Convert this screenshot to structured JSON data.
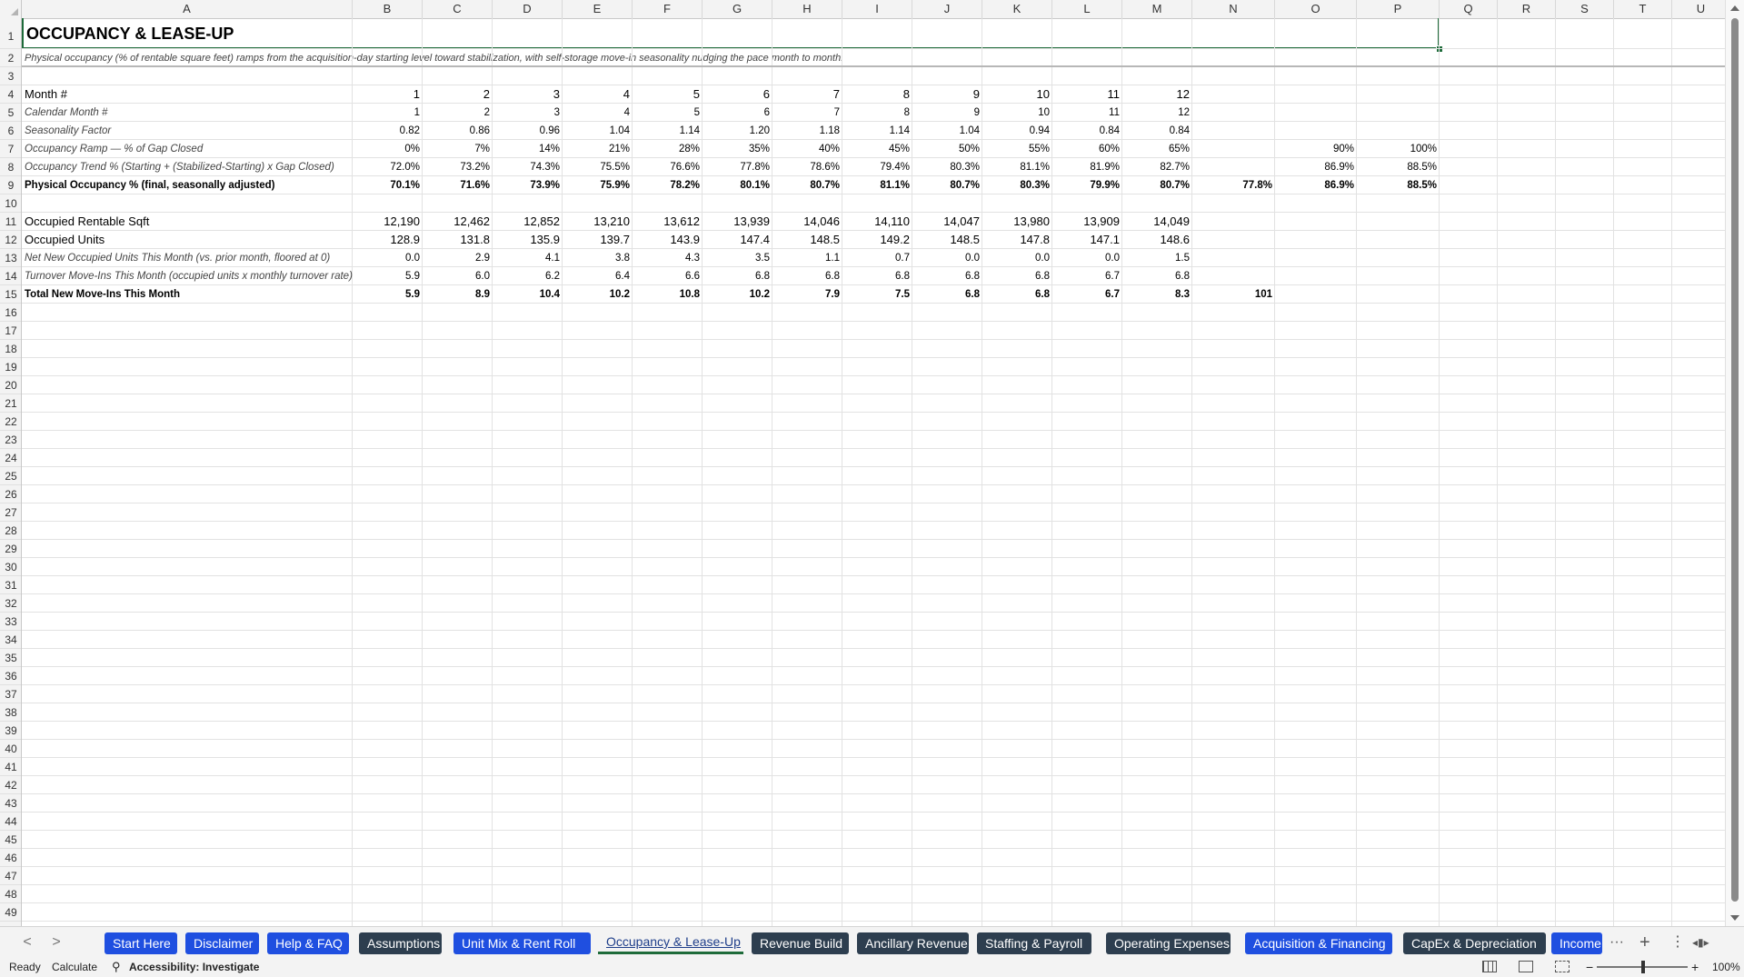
{
  "columns": [
    "A",
    "B",
    "C",
    "D",
    "E",
    "F",
    "G",
    "H",
    "I",
    "J",
    "K",
    "L",
    "M",
    "N",
    "O",
    "P",
    "Q",
    "R",
    "S",
    "T",
    "U"
  ],
  "row_numbers": [
    "1",
    "2",
    "3",
    "4",
    "5",
    "6",
    "7",
    "8",
    "9",
    "10",
    "11",
    "12",
    "13",
    "14",
    "15",
    "16",
    "17",
    "18",
    "19",
    "20",
    "21",
    "22",
    "23",
    "24",
    "25",
    "26",
    "27",
    "28",
    "29",
    "30",
    "31",
    "32",
    "33",
    "34",
    "35",
    "36",
    "37",
    "38",
    "39",
    "40",
    "41",
    "42",
    "43",
    "44",
    "45",
    "46",
    "47",
    "48",
    "49"
  ],
  "sheet": {
    "title": "OCCUPANCY & LEASE-UP",
    "subtitle": "Physical occupancy (% of rentable square feet) ramps from the acquisition-day starting level toward stabilization, with self-storage move-in seasonality nudging the pace month to month.",
    "rows": [
      {
        "row": 4,
        "style": "normal",
        "label": "Month #",
        "values": [
          "1",
          "2",
          "3",
          "4",
          "5",
          "6",
          "7",
          "8",
          "9",
          "10",
          "11",
          "12"
        ],
        "extra": {}
      },
      {
        "row": 5,
        "style": "italic",
        "label": "Calendar Month #",
        "values": [
          "1",
          "2",
          "3",
          "4",
          "5",
          "6",
          "7",
          "8",
          "9",
          "10",
          "11",
          "12"
        ],
        "extra": {}
      },
      {
        "row": 6,
        "style": "italic",
        "label": "Seasonality Factor",
        "values": [
          "0.82",
          "0.86",
          "0.96",
          "1.04",
          "1.14",
          "1.20",
          "1.18",
          "1.14",
          "1.04",
          "0.94",
          "0.84",
          "0.84"
        ],
        "extra": {}
      },
      {
        "row": 7,
        "style": "italic",
        "label": "Occupancy Ramp — % of Gap Closed",
        "values": [
          "0%",
          "7%",
          "14%",
          "21%",
          "28%",
          "35%",
          "40%",
          "45%",
          "50%",
          "55%",
          "60%",
          "65%"
        ],
        "extra": {
          "O": "90%",
          "P": "100%"
        }
      },
      {
        "row": 8,
        "style": "italic",
        "label": "Occupancy Trend % (Starting + (Stabilized-Starting) x Gap Closed)",
        "values": [
          "72.0%",
          "73.2%",
          "74.3%",
          "75.5%",
          "76.6%",
          "77.8%",
          "78.6%",
          "79.4%",
          "80.3%",
          "81.1%",
          "81.9%",
          "82.7%"
        ],
        "extra": {
          "O": "86.9%",
          "P": "88.5%"
        }
      },
      {
        "row": 9,
        "style": "bold",
        "label": "Physical Occupancy % (final, seasonally adjusted)",
        "values": [
          "70.1%",
          "71.6%",
          "73.9%",
          "75.9%",
          "78.2%",
          "80.1%",
          "80.7%",
          "81.1%",
          "80.7%",
          "80.3%",
          "79.9%",
          "80.7%"
        ],
        "extra": {
          "N": "77.8%",
          "O": "86.9%",
          "P": "88.5%"
        }
      },
      {
        "row": 11,
        "style": "normal",
        "label": "Occupied Rentable Sqft",
        "values": [
          "12,190",
          "12,462",
          "12,852",
          "13,210",
          "13,612",
          "13,939",
          "14,046",
          "14,110",
          "14,047",
          "13,980",
          "13,909",
          "14,049"
        ],
        "extra": {}
      },
      {
        "row": 12,
        "style": "normal",
        "label": "Occupied Units",
        "values": [
          "128.9",
          "131.8",
          "135.9",
          "139.7",
          "143.9",
          "147.4",
          "148.5",
          "149.2",
          "148.5",
          "147.8",
          "147.1",
          "148.6"
        ],
        "extra": {}
      },
      {
        "row": 13,
        "style": "italic",
        "label": "Net New Occupied Units This Month (vs. prior month, floored at 0)",
        "values": [
          "0.0",
          "2.9",
          "4.1",
          "3.8",
          "4.3",
          "3.5",
          "1.1",
          "0.7",
          "0.0",
          "0.0",
          "0.0",
          "1.5"
        ],
        "extra": {}
      },
      {
        "row": 14,
        "style": "italic",
        "label": "Turnover Move-Ins This Month (occupied units x monthly turnover rate)",
        "values": [
          "5.9",
          "6.0",
          "6.2",
          "6.4",
          "6.6",
          "6.8",
          "6.8",
          "6.8",
          "6.8",
          "6.8",
          "6.7",
          "6.8"
        ],
        "extra": {}
      },
      {
        "row": 15,
        "style": "bold",
        "label": "Total New Move-Ins This Month",
        "values": [
          "5.9",
          "8.9",
          "10.4",
          "10.2",
          "10.8",
          "10.2",
          "7.9",
          "7.5",
          "6.8",
          "6.8",
          "6.7",
          "8.3"
        ],
        "extra": {
          "N": "101"
        }
      }
    ]
  },
  "tabs": {
    "prev": "<",
    "next": ">",
    "items": [
      {
        "label": "Start Here",
        "color": "blue"
      },
      {
        "label": "Disclaimer",
        "color": "blue"
      },
      {
        "label": "Help & FAQ",
        "color": "blue"
      },
      {
        "label": "Assumptions",
        "color": "dark"
      },
      {
        "label": "Unit Mix & Rent Roll",
        "color": "blue"
      },
      {
        "label": "Occupancy & Lease-Up",
        "color": "active"
      },
      {
        "label": "Revenue Build",
        "color": "dark"
      },
      {
        "label": "Ancillary Revenue",
        "color": "dark"
      },
      {
        "label": "Staffing & Payroll",
        "color": "dark"
      },
      {
        "label": "Operating Expenses",
        "color": "dark"
      },
      {
        "label": "Acquisition & Financing",
        "color": "blue"
      },
      {
        "label": "CapEx & Depreciation",
        "color": "dark"
      },
      {
        "label": "Income",
        "color": "blue"
      }
    ],
    "more": "···",
    "add": "+",
    "menu": "⋮"
  },
  "status": {
    "ready": "Ready",
    "calculate": "Calculate",
    "accessibility": "Accessibility: Investigate",
    "zoom": "100%",
    "zoom_minus": "−",
    "zoom_plus": "+"
  },
  "colors": {
    "tab_blue": "#1f4fe0",
    "tab_dark": "#2d3e4f",
    "selection": "#1e6b3a"
  }
}
